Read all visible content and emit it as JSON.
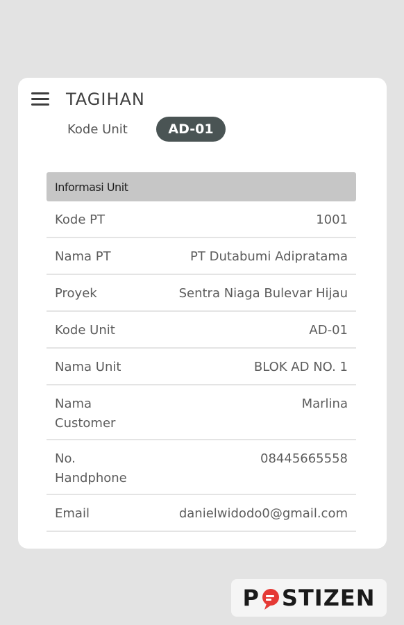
{
  "header": {
    "title": "TAGIHAN",
    "unit_label": "Kode Unit",
    "unit_code": "AD-01"
  },
  "section": {
    "title": "Informasi Unit"
  },
  "rows": [
    {
      "label": "Kode PT",
      "value": "1001"
    },
    {
      "label": "Nama PT",
      "value": "PT Dutabumi Adipratama"
    },
    {
      "label": "Proyek",
      "value": "Sentra Niaga Bulevar Hijau"
    },
    {
      "label": "Kode Unit",
      "value": "AD-01"
    },
    {
      "label": "Nama Unit",
      "value": "BLOK AD NO. 1"
    },
    {
      "label": "Nama Customer",
      "value": "Marlina"
    },
    {
      "label": "No. Handphone",
      "value": "08445665558"
    },
    {
      "label": "Email",
      "value": "danielwidodo0@gmail.com"
    }
  ],
  "watermark": {
    "text": "POSTIZEN",
    "left": "P",
    "right": "STIZEN",
    "accent_color": "#e53935"
  },
  "colors": {
    "background": "#e3e3e3",
    "card": "#ffffff",
    "badge": "#4a5454",
    "section_header": "#c6c6c6"
  }
}
